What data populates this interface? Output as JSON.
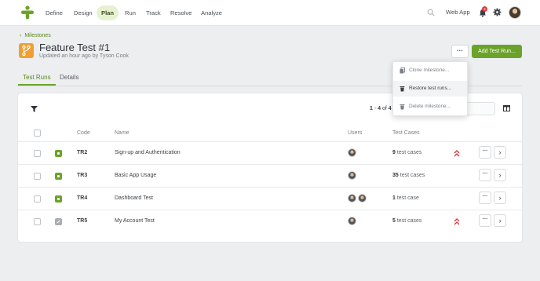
{
  "nav": {
    "items": [
      {
        "label": "Define",
        "active": false
      },
      {
        "label": "Design",
        "active": false
      },
      {
        "label": "Plan",
        "active": true
      },
      {
        "label": "Run",
        "active": false
      },
      {
        "label": "Track",
        "active": false
      },
      {
        "label": "Resolve",
        "active": false
      },
      {
        "label": "Analyze",
        "active": false
      }
    ],
    "project": "Web App",
    "notification_count": "2"
  },
  "breadcrumb": "Milestones",
  "page": {
    "title": "Feature Test #1",
    "subtitle": "Updated an hour ago by Tyson Cook",
    "more_label": "···",
    "add_button": "Add Test Run..."
  },
  "tabs": [
    {
      "label": "Test Runs",
      "active": true
    },
    {
      "label": "Details",
      "active": false
    }
  ],
  "menu": {
    "items": [
      {
        "label": "Clone milestone...",
        "icon": "copy-icon"
      },
      {
        "label": "Restore test runs...",
        "icon": "trash-icon"
      },
      {
        "label": "Delete milestone...",
        "icon": "trash-icon"
      }
    ]
  },
  "table": {
    "range": {
      "start": "1",
      "end": "4",
      "of": "of",
      "total": "4"
    },
    "columns": {
      "code": "Code",
      "name": "Name",
      "users": "Users",
      "cases": "Test Cases"
    },
    "rows": [
      {
        "status": "active",
        "code": "TR2",
        "name": "Sign-up and Authentication",
        "users": 1,
        "cases_num": "9",
        "cases_label": "test cases",
        "high_priority": true
      },
      {
        "status": "active",
        "code": "TR3",
        "name": "Basic App Usage",
        "users": 1,
        "cases_num": "35",
        "cases_label": "test cases",
        "high_priority": false
      },
      {
        "status": "active",
        "code": "TR4",
        "name": "Dashboard Test",
        "users": 2,
        "cases_num": "1",
        "cases_label": "test case",
        "high_priority": false
      },
      {
        "status": "edited",
        "code": "TR5",
        "name": "My Account Test",
        "users": 1,
        "cases_num": "5",
        "cases_label": "test cases",
        "high_priority": true
      }
    ],
    "row_more": "···",
    "row_open": "›"
  },
  "colors": {
    "accent": "#6ba32a",
    "priority": "#e0383e",
    "milestone": "#f0a030"
  }
}
